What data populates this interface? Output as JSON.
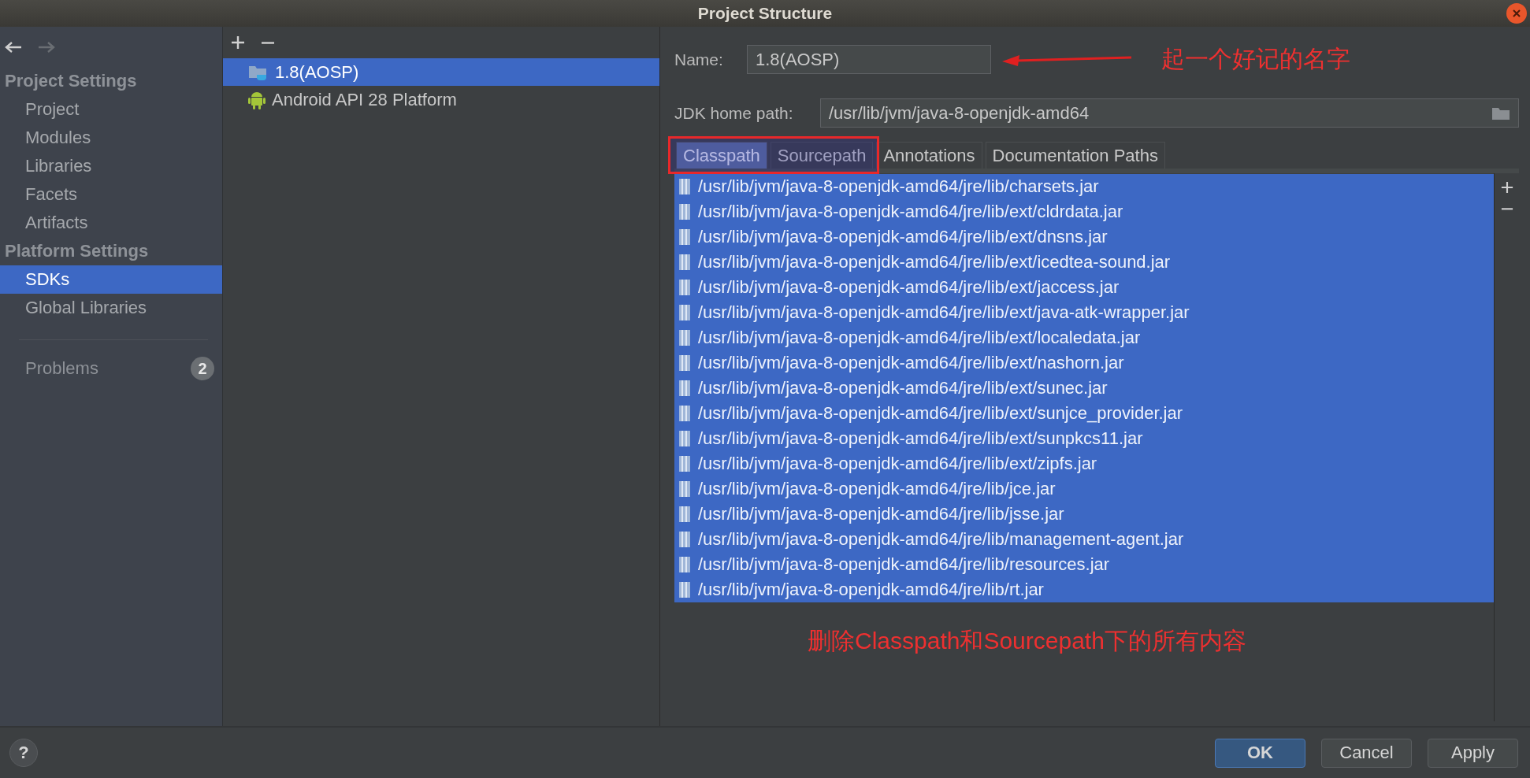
{
  "window": {
    "title": "Project Structure"
  },
  "navigation": {
    "back_disabled": false,
    "forward_disabled": true
  },
  "sidebar": {
    "sections": [
      {
        "title": "Project Settings",
        "items": [
          {
            "label": "Project",
            "selected": false
          },
          {
            "label": "Modules",
            "selected": false
          },
          {
            "label": "Libraries",
            "selected": false
          },
          {
            "label": "Facets",
            "selected": false
          },
          {
            "label": "Artifacts",
            "selected": false
          }
        ]
      },
      {
        "title": "Platform Settings",
        "items": [
          {
            "label": "SDKs",
            "selected": true
          },
          {
            "label": "Global Libraries",
            "selected": false
          }
        ]
      }
    ],
    "problems": {
      "label": "Problems",
      "count": "2"
    }
  },
  "sdk_list": {
    "items": [
      {
        "label": "1.8(AOSP)",
        "kind": "jdk",
        "selected": true
      },
      {
        "label": "Android API 28 Platform",
        "kind": "android",
        "selected": false
      }
    ]
  },
  "detail": {
    "name_label": "Name:",
    "name_value": "1.8(AOSP)",
    "home_label": "JDK home path:",
    "home_value": "/usr/lib/jvm/java-8-openjdk-amd64",
    "tabs": [
      {
        "label": "Classpath",
        "selected": true
      },
      {
        "label": "Sourcepath",
        "selected": false
      },
      {
        "label": "Annotations",
        "selected": false
      },
      {
        "label": "Documentation Paths",
        "selected": false
      }
    ],
    "paths": [
      {
        "path": "/usr/lib/jvm/java-8-openjdk-amd64/jre/lib/charsets.jar",
        "selected": true
      },
      {
        "path": "/usr/lib/jvm/java-8-openjdk-amd64/jre/lib/ext/cldrdata.jar",
        "selected": true
      },
      {
        "path": "/usr/lib/jvm/java-8-openjdk-amd64/jre/lib/ext/dnsns.jar",
        "selected": true
      },
      {
        "path": "/usr/lib/jvm/java-8-openjdk-amd64/jre/lib/ext/icedtea-sound.jar",
        "selected": true
      },
      {
        "path": "/usr/lib/jvm/java-8-openjdk-amd64/jre/lib/ext/jaccess.jar",
        "selected": true
      },
      {
        "path": "/usr/lib/jvm/java-8-openjdk-amd64/jre/lib/ext/java-atk-wrapper.jar",
        "selected": true
      },
      {
        "path": "/usr/lib/jvm/java-8-openjdk-amd64/jre/lib/ext/localedata.jar",
        "selected": true
      },
      {
        "path": "/usr/lib/jvm/java-8-openjdk-amd64/jre/lib/ext/nashorn.jar",
        "selected": true
      },
      {
        "path": "/usr/lib/jvm/java-8-openjdk-amd64/jre/lib/ext/sunec.jar",
        "selected": true
      },
      {
        "path": "/usr/lib/jvm/java-8-openjdk-amd64/jre/lib/ext/sunjce_provider.jar",
        "selected": true
      },
      {
        "path": "/usr/lib/jvm/java-8-openjdk-amd64/jre/lib/ext/sunpkcs11.jar",
        "selected": true
      },
      {
        "path": "/usr/lib/jvm/java-8-openjdk-amd64/jre/lib/ext/zipfs.jar",
        "selected": true
      },
      {
        "path": "/usr/lib/jvm/java-8-openjdk-amd64/jre/lib/jce.jar",
        "selected": true
      },
      {
        "path": "/usr/lib/jvm/java-8-openjdk-amd64/jre/lib/jsse.jar",
        "selected": true
      },
      {
        "path": "/usr/lib/jvm/java-8-openjdk-amd64/jre/lib/management-agent.jar",
        "selected": true
      },
      {
        "path": "/usr/lib/jvm/java-8-openjdk-amd64/jre/lib/resources.jar",
        "selected": true
      },
      {
        "path": "/usr/lib/jvm/java-8-openjdk-amd64/jre/lib/rt.jar",
        "selected": true
      }
    ]
  },
  "annotations": [
    {
      "kind": "callout",
      "text": "起一个好记的名字"
    },
    {
      "kind": "highlight"
    },
    {
      "kind": "note",
      "text": "删除Classpath和Sourcepath下的所有内容"
    }
  ],
  "help": {
    "label": "?"
  },
  "buttons": [
    {
      "label": "OK",
      "kind": "primary"
    },
    {
      "label": "Cancel",
      "kind": "default"
    },
    {
      "label": "Apply",
      "kind": "default"
    }
  ]
}
